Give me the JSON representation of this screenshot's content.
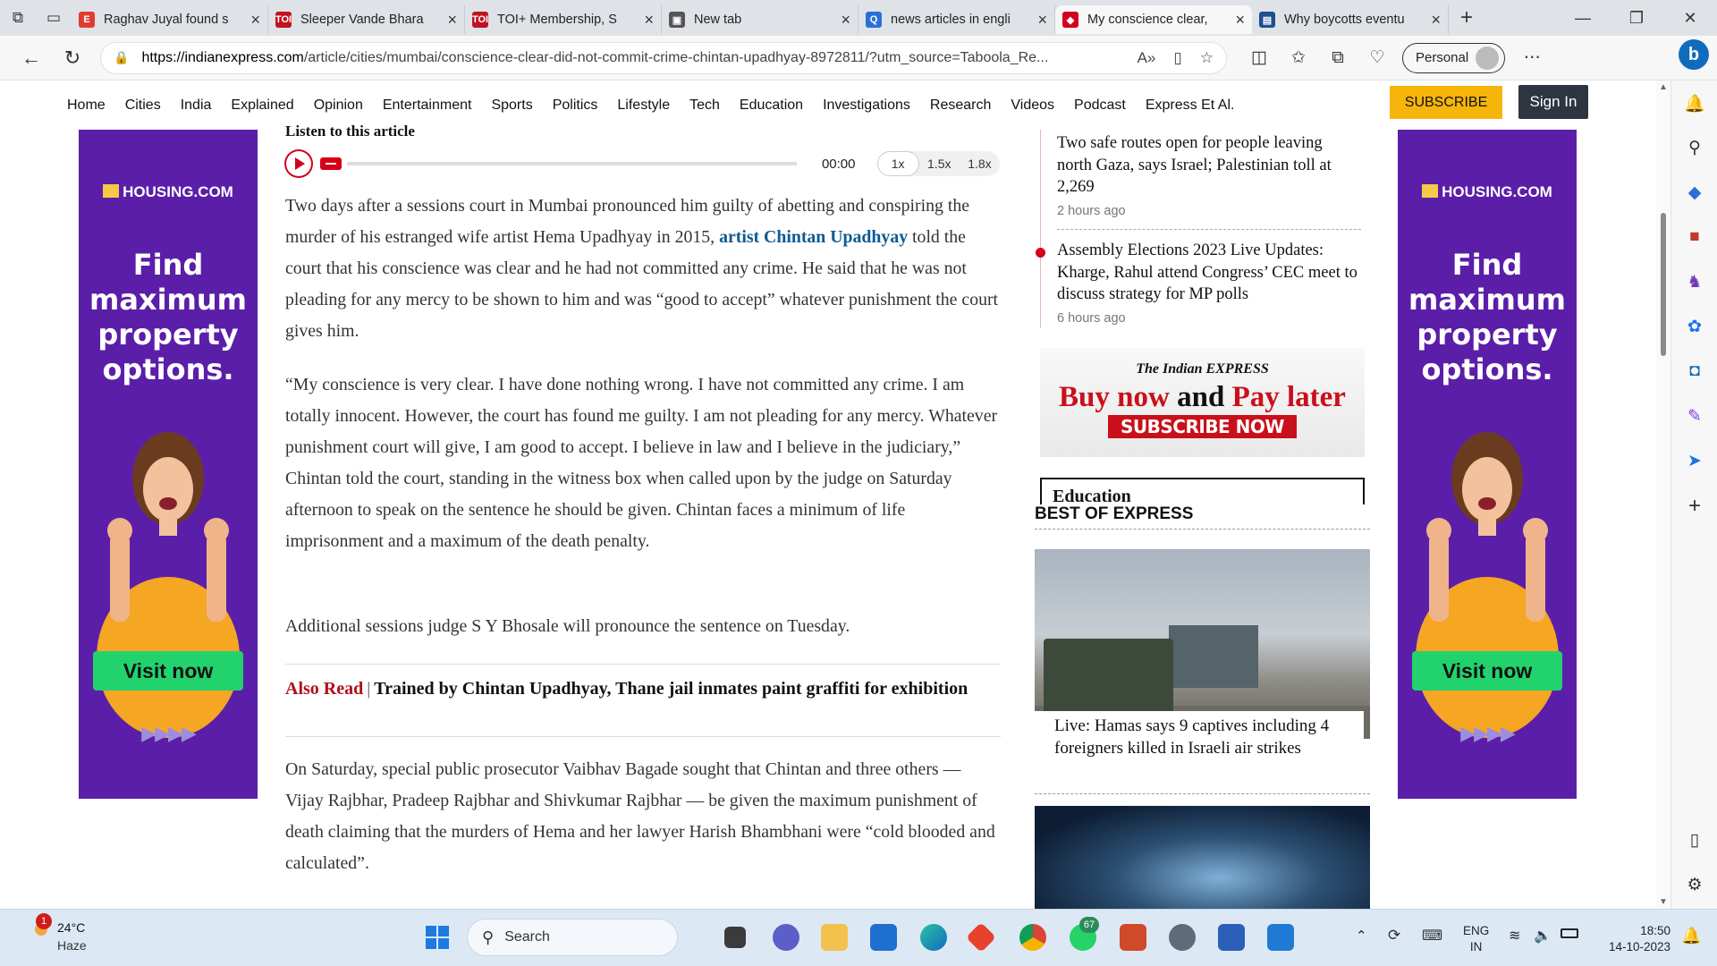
{
  "browser": {
    "tabs": [
      {
        "title": "Raghav Juyal found s",
        "favicon_color": "#e23b2e",
        "favicon_text": "E"
      },
      {
        "title": "Sleeper Vande Bhara",
        "favicon_color": "#c1121f",
        "favicon_text": "TOI"
      },
      {
        "title": "TOI+ Membership, S",
        "favicon_color": "#c1121f",
        "favicon_text": "TOI"
      },
      {
        "title": "New tab",
        "favicon_color": "#555555",
        "favicon_text": "▣"
      },
      {
        "title": "news articles in engli",
        "favicon_color": "#2b6fd6",
        "favicon_text": "Q"
      },
      {
        "title": "My conscience clear,",
        "favicon_color": "#d4001b",
        "favicon_text": "◆"
      },
      {
        "title": "Why boycotts eventu",
        "favicon_color": "#1d4f91",
        "favicon_text": "▤"
      }
    ],
    "url_host": "https://indianexpress.com",
    "url_path": "/article/cities/mumbai/conscience-clear-did-not-commit-crime-chintan-upadhyay-8972811/?utm_source=Taboola_Re...",
    "profile_label": "Personal"
  },
  "site_nav": {
    "items": [
      "Home",
      "Cities",
      "India",
      "Explained",
      "Opinion",
      "Entertainment",
      "Sports",
      "Politics",
      "Lifestyle",
      "Tech",
      "Education",
      "Investigations",
      "Research",
      "Videos",
      "Podcast",
      "Express Et Al."
    ],
    "subscribe_label": "SUBSCRIBE",
    "signin_label": "Sign In"
  },
  "ad": {
    "logo": "HOUSING.COM",
    "headline": "Find maximum property options.",
    "cta": "Visit now",
    "arrows": "▶▶▶▶"
  },
  "article": {
    "listen_label": "Listen to this article",
    "player": {
      "time": "00:00",
      "speeds": [
        "1x",
        "1.5x",
        "1.8x"
      ]
    },
    "p1_before": "Two days after a sessions court in Mumbai pronounced him guilty of abetting and conspiring the murder of his estranged wife artist Hema Upadhyay in 2015, ",
    "p1_link": "artist Chintan Upadhyay",
    "p1_after": " told the court that his conscience was clear and he had not committed any crime. He said that he was not pleading for any mercy to be shown to him and was “good to accept” whatever punishment the court gives him.",
    "p2": "“My conscience is very clear. I have done nothing wrong. I have not committed any crime. I am totally innocent. However, the court has found me guilty. I am not pleading for any mercy. Whatever punishment court will give, I am good to accept. I believe in law and I believe in the judiciary,” Chintan told the court, standing in the witness box when called upon by the judge on Saturday afternoon to speak on the sentence he should be given. Chintan faces a minimum of life imprisonment and a maximum of the death penalty.",
    "p3": "Additional sessions judge S Y Bhosale will pronounce the sentence on Tuesday.",
    "also_read_label": "Also Read",
    "also_read_title": "Trained by Chintan Upadhyay, Thane jail inmates paint graffiti for exhibition",
    "p4": "On Saturday, special public prosecutor Vaibhav Bagade sought that Chintan and three others — Vijay Rajbhar, Pradeep Rajbhar and Shivkumar Rajbhar — be given the maximum punishment of death claiming that the murders of Hema and her lawyer Harish Bhambhani were “cold blooded and calculated”."
  },
  "sidebar": {
    "live_items": [
      {
        "title": "Two safe routes open for people leaving north Gaza, says Israel; Palestinian toll at 2,269",
        "ago": "2 hours ago"
      },
      {
        "title": "Assembly Elections 2023 Live Updates: Kharge, Rahul attend Congress’ CEC meet to discuss strategy for MP polls",
        "ago": "6 hours ago"
      }
    ],
    "ie_banner": {
      "brand": "The Indian EXPRESS",
      "buy": "Buy now",
      "and": "and",
      "pay": "Pay later",
      "subscribe": "SUBSCRIBE NOW"
    },
    "edu_label": "Education",
    "best_title": "BEST OF EXPRESS",
    "best_caption": "Live: Hamas says 9 captives including 4 foreigners killed in Israeli air strikes"
  },
  "taskbar": {
    "weather_temp": "24°C",
    "weather_desc": "Haze",
    "weather_badge": "1",
    "search_label": "Search",
    "whatsapp_badge": "67",
    "lang_top": "ENG",
    "lang_bottom": "IN",
    "time": "18:50",
    "date": "14-10-2023"
  }
}
